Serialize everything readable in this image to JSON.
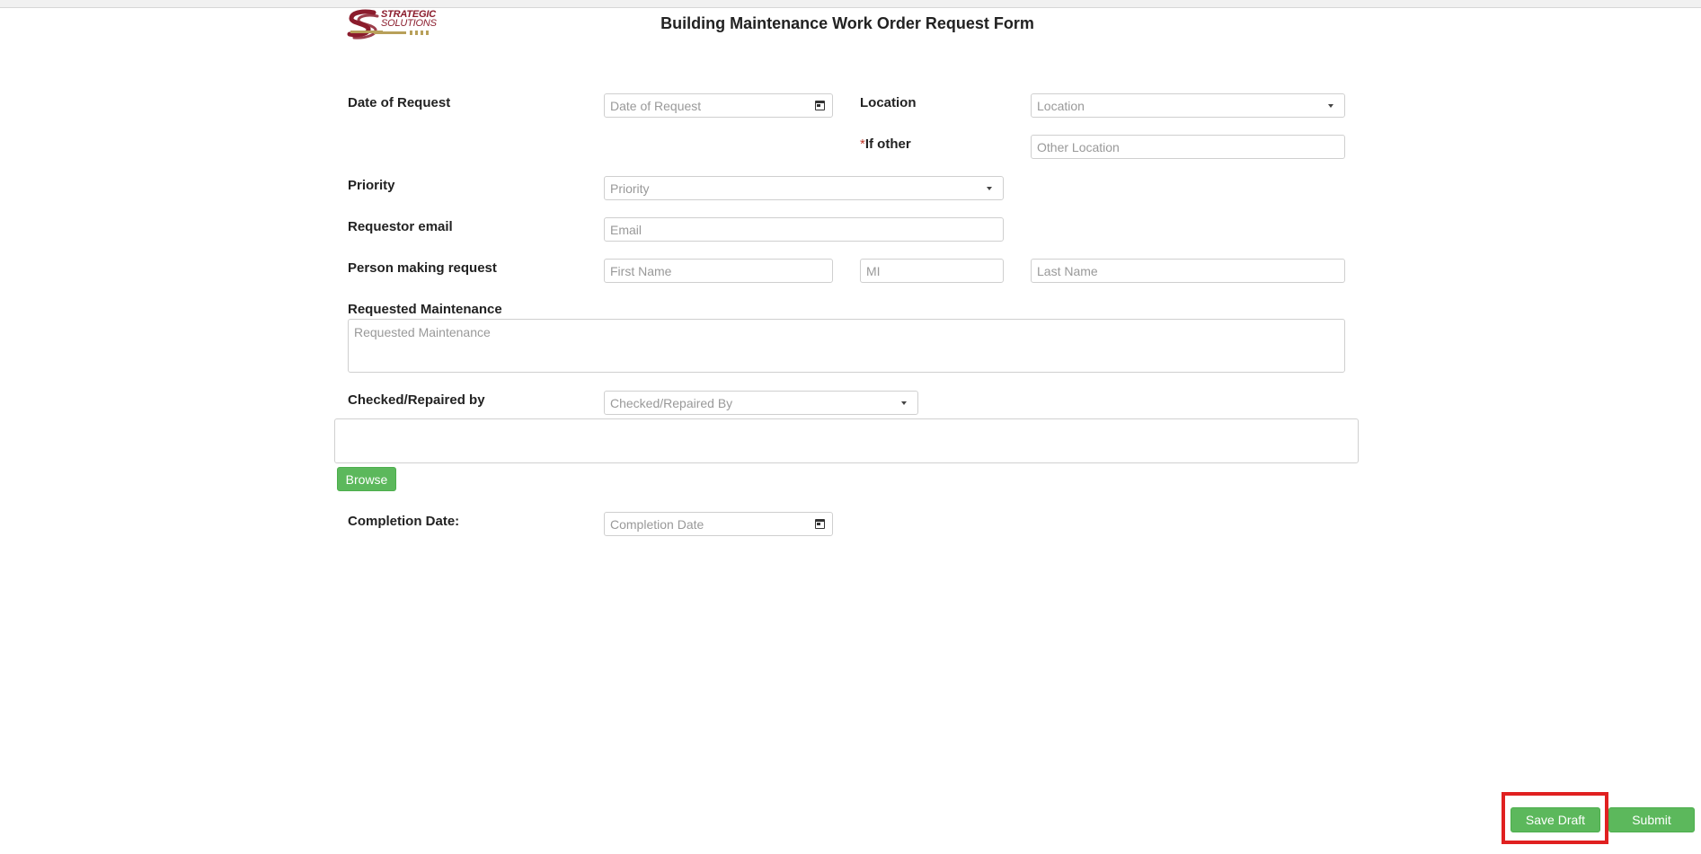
{
  "logo": {
    "line1": "STRATEGIC",
    "line2": "SOLUTIONS",
    "colors": {
      "primary": "#8b1c2c",
      "accent": "#b8a05a"
    }
  },
  "form": {
    "title": "Building Maintenance Work Order Request Form",
    "date_of_request": {
      "label": "Date of Request",
      "placeholder": "Date of Request"
    },
    "location": {
      "label": "Location",
      "placeholder": "Location"
    },
    "if_other": {
      "required_mark": "*",
      "label": "If other",
      "placeholder": "Other Location"
    },
    "priority": {
      "label": "Priority",
      "placeholder": "Priority"
    },
    "requestor_email": {
      "label": "Requestor email",
      "placeholder": "Email"
    },
    "person_making_request": {
      "label": "Person making request",
      "first_placeholder": "First Name",
      "mi_placeholder": "MI",
      "last_placeholder": "Last Name"
    },
    "requested_maintenance": {
      "label": "Requested Maintenance",
      "placeholder": "Requested Maintenance"
    },
    "checked_repaired_by": {
      "label": "Checked/Repaired by",
      "placeholder": "Checked/Repaired By"
    },
    "browse_label": "Browse",
    "completion_date": {
      "label": "Completion Date:",
      "placeholder": "Completion Date"
    }
  },
  "actions": {
    "save_draft": "Save Draft",
    "submit": "Submit"
  },
  "colors": {
    "button_green": "#5cb85c",
    "highlight_red": "#e02020"
  }
}
